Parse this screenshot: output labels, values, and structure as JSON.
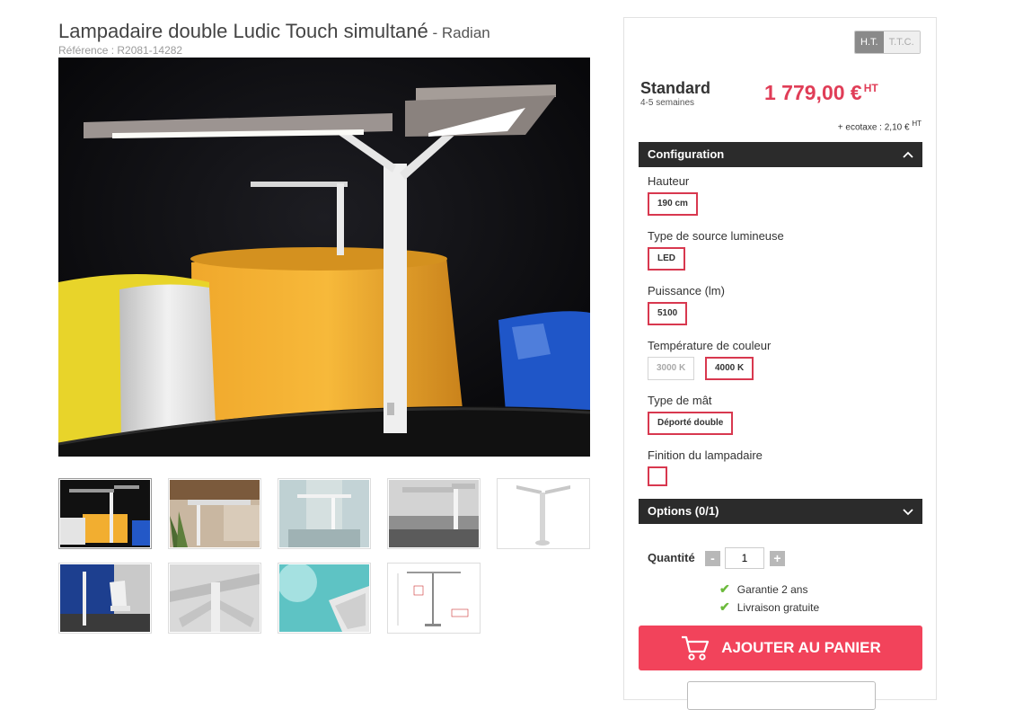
{
  "product": {
    "title": "Lampadaire double Ludic Touch simultané",
    "brand_sep": " - ",
    "brand": "Radian",
    "reference": "Référence : R2081-14282"
  },
  "price_panel": {
    "toggle_ht": "H.T.",
    "toggle_ttc": "T.T.C.",
    "standard": "Standard",
    "delay": "4-5 semaines",
    "price": "1 779,00 €",
    "price_suffix": "HT",
    "ecotaxe": "+ ecotaxe : 2,10 €",
    "ecotaxe_suffix": "HT"
  },
  "configuration": {
    "title": "Configuration",
    "options": [
      {
        "label": "Hauteur",
        "values": [
          "190 cm"
        ]
      },
      {
        "label": "Type de source lumineuse",
        "values": [
          "LED"
        ]
      },
      {
        "label": "Puissance (lm)",
        "values": [
          "5100"
        ]
      },
      {
        "label": "Température de couleur",
        "values": [
          "3000 K",
          "4000 K"
        ]
      },
      {
        "label": "Type de mât",
        "values": [
          "Déporté double"
        ]
      },
      {
        "label": "Finition du lampadaire",
        "values": [
          ""
        ]
      }
    ]
  },
  "options_section": {
    "title": "Options (0/1)"
  },
  "quantity": {
    "label": "Quantité",
    "value": "1",
    "minus": "-",
    "plus": "+"
  },
  "features": [
    "Garantie 2 ans",
    "Livraison gratuite"
  ],
  "cart": {
    "label": "AJOUTER AU PANIER"
  },
  "colors": {
    "accent": "#f2435b",
    "price": "#e03d57",
    "dark_bar": "#2b2b2b",
    "check": "#6cba3c"
  },
  "icons": {
    "collapse": "chevron-up-icon",
    "expand": "chevron-down-icon",
    "cart": "cart-icon",
    "check": "check-icon"
  }
}
